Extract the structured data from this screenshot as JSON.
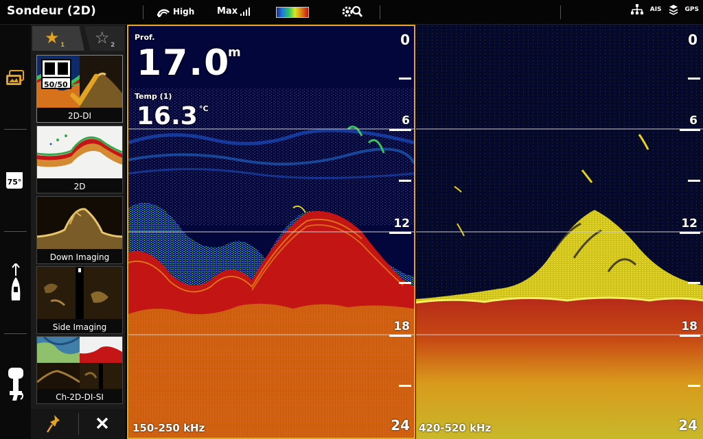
{
  "app": {
    "title": "Sondeur (2D)"
  },
  "topbar": {
    "ping_icon": "ping-speed-icon",
    "ping_label": "High",
    "sensitivity_label": "Max",
    "sensitivity_icon": "signal-bars-icon",
    "palette_icon": "color-palette-swatch",
    "settings_icon": "gear-search-icon",
    "status": {
      "network_icon": "network-icon",
      "ais_label": "AIS",
      "layers_icon": "layers-icon",
      "gps_label": "GPS"
    }
  },
  "rail": [
    {
      "icon": "views-stack-icon"
    },
    {
      "icon": "temperature-75-icon",
      "text": "75°"
    },
    {
      "icon": "boat-heading-icon"
    },
    {
      "icon": "outboard-motor-icon"
    }
  ],
  "favorites": {
    "tabs": [
      {
        "sub": "1",
        "active": true
      },
      {
        "sub": "2",
        "active": false
      }
    ],
    "tiles": [
      {
        "label": "2D-DI",
        "badge": "50/50",
        "selected": true
      },
      {
        "label": "2D"
      },
      {
        "label": "Down Imaging"
      },
      {
        "label": "Side Imaging"
      },
      {
        "label": "Ch-2D-DI-SI"
      }
    ],
    "pin_icon": "pin-icon",
    "close_icon": "close-icon"
  },
  "sonar_left": {
    "depth_label": "Prof.",
    "depth_value": "17.0",
    "depth_unit": "m",
    "temp_label": "Temp (1)",
    "temp_value": "16.3",
    "temp_unit": "°C",
    "frequency": "150-250 kHz",
    "scale": [
      "0",
      "6",
      "12",
      "18",
      "24"
    ],
    "colors": {
      "water": "#04083a",
      "bottom": "#d2620f",
      "fish": "#c51515"
    }
  },
  "sonar_right": {
    "frequency": "420-520 kHz",
    "scale": [
      "0",
      "6",
      "12",
      "18",
      "24"
    ],
    "colors": {
      "water": "#050a2c",
      "bottom": "#c4301a",
      "return": "#e8d21e"
    }
  }
}
